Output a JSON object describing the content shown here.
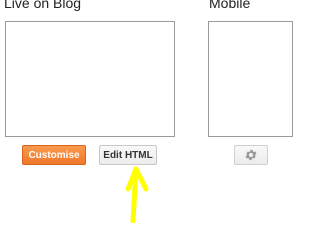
{
  "live_section": {
    "heading": "Live on Blog",
    "customise_label": "Customise",
    "edit_html_label": "Edit HTML"
  },
  "mobile_section": {
    "heading": "Mobile",
    "settings_icon": "gear-icon"
  },
  "annotation": {
    "arrow_icon": "up-arrow-icon",
    "arrow_color": "#ffff00"
  },
  "colors": {
    "customise_button": "#f58a3a",
    "edit_html_button": "#f2f2f2",
    "heading_text": "#222222"
  }
}
